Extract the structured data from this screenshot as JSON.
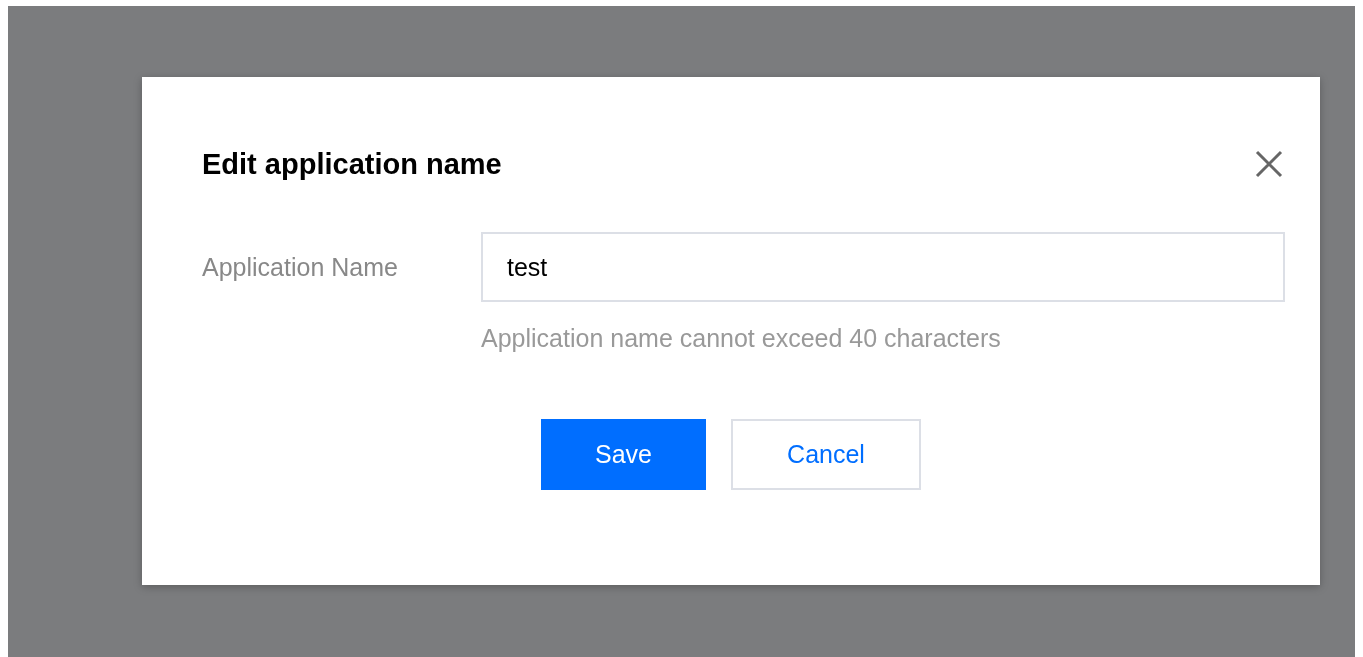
{
  "dialog": {
    "title": "Edit application name",
    "fields": [
      {
        "label": "Application Name",
        "value": "test",
        "help": "Application name cannot exceed 40 characters"
      }
    ],
    "buttons": [
      {
        "label": "Save",
        "kind": "primary"
      },
      {
        "label": "Cancel",
        "kind": "secondary"
      }
    ]
  }
}
